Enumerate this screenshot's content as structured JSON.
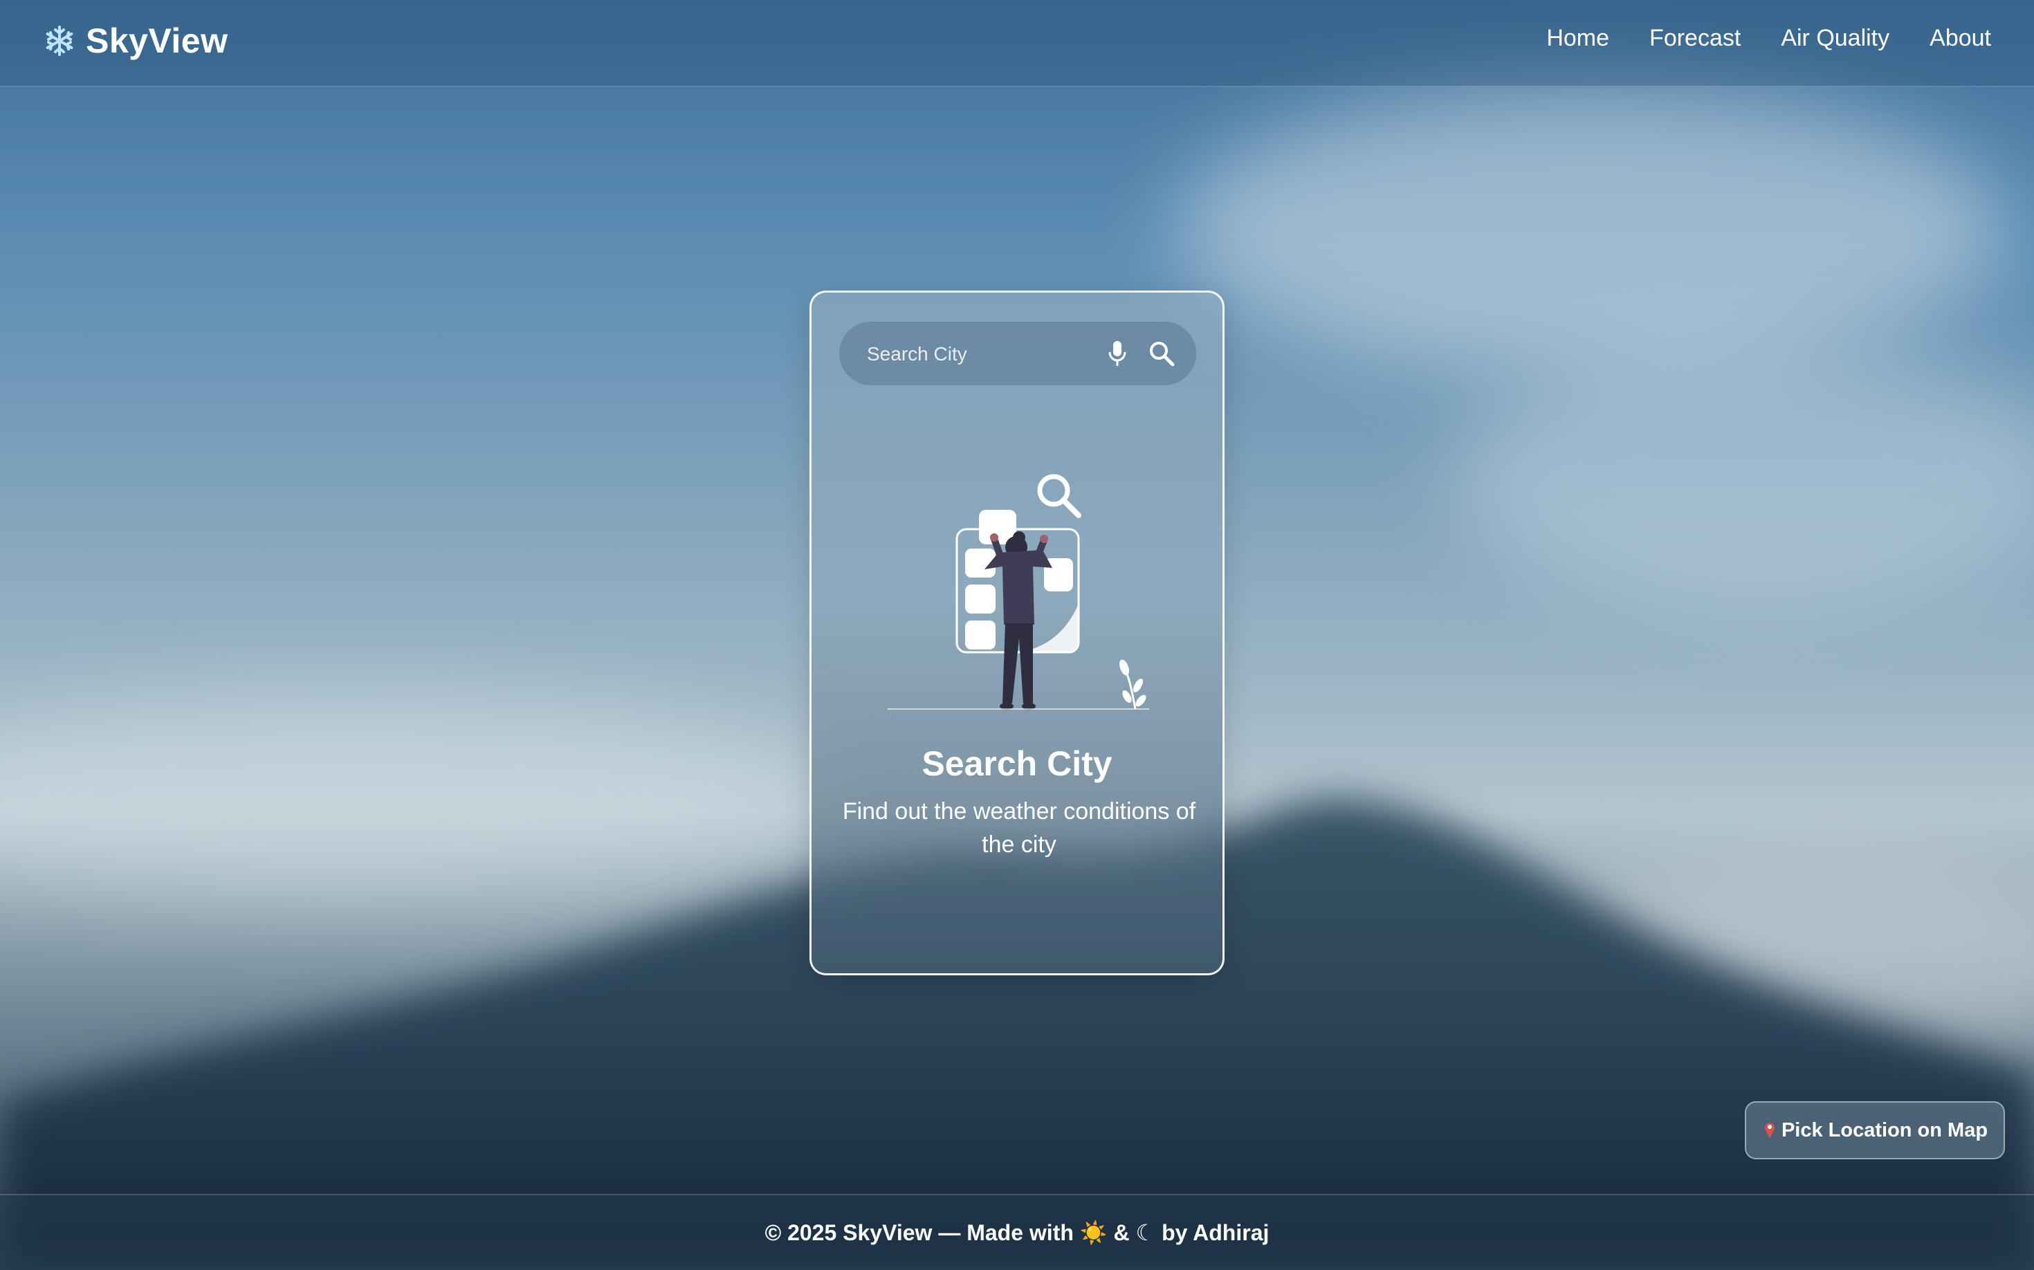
{
  "brand": {
    "icon": "snowflake-icon",
    "name": "SkyView"
  },
  "nav": {
    "items": [
      {
        "label": "Home"
      },
      {
        "label": "Forecast"
      },
      {
        "label": "Air Quality"
      },
      {
        "label": "About"
      }
    ]
  },
  "search": {
    "placeholder": "Search City",
    "mic_icon": "microphone-icon",
    "search_icon": "search-icon"
  },
  "empty_state": {
    "illustration": "person-searching-illustration",
    "title": "Search City",
    "subtitle": "Find out the weather conditions of the city"
  },
  "pick_location": {
    "icon": "map-pin-icon",
    "label": "Pick Location on Map"
  },
  "footer": {
    "text": "© 2025 SkyView — Made with ☀️ & ☾ by Adhiraj"
  },
  "colors": {
    "text": "#ffffff",
    "pin": "#d9534f",
    "snowflake": "#bfe3ff"
  }
}
